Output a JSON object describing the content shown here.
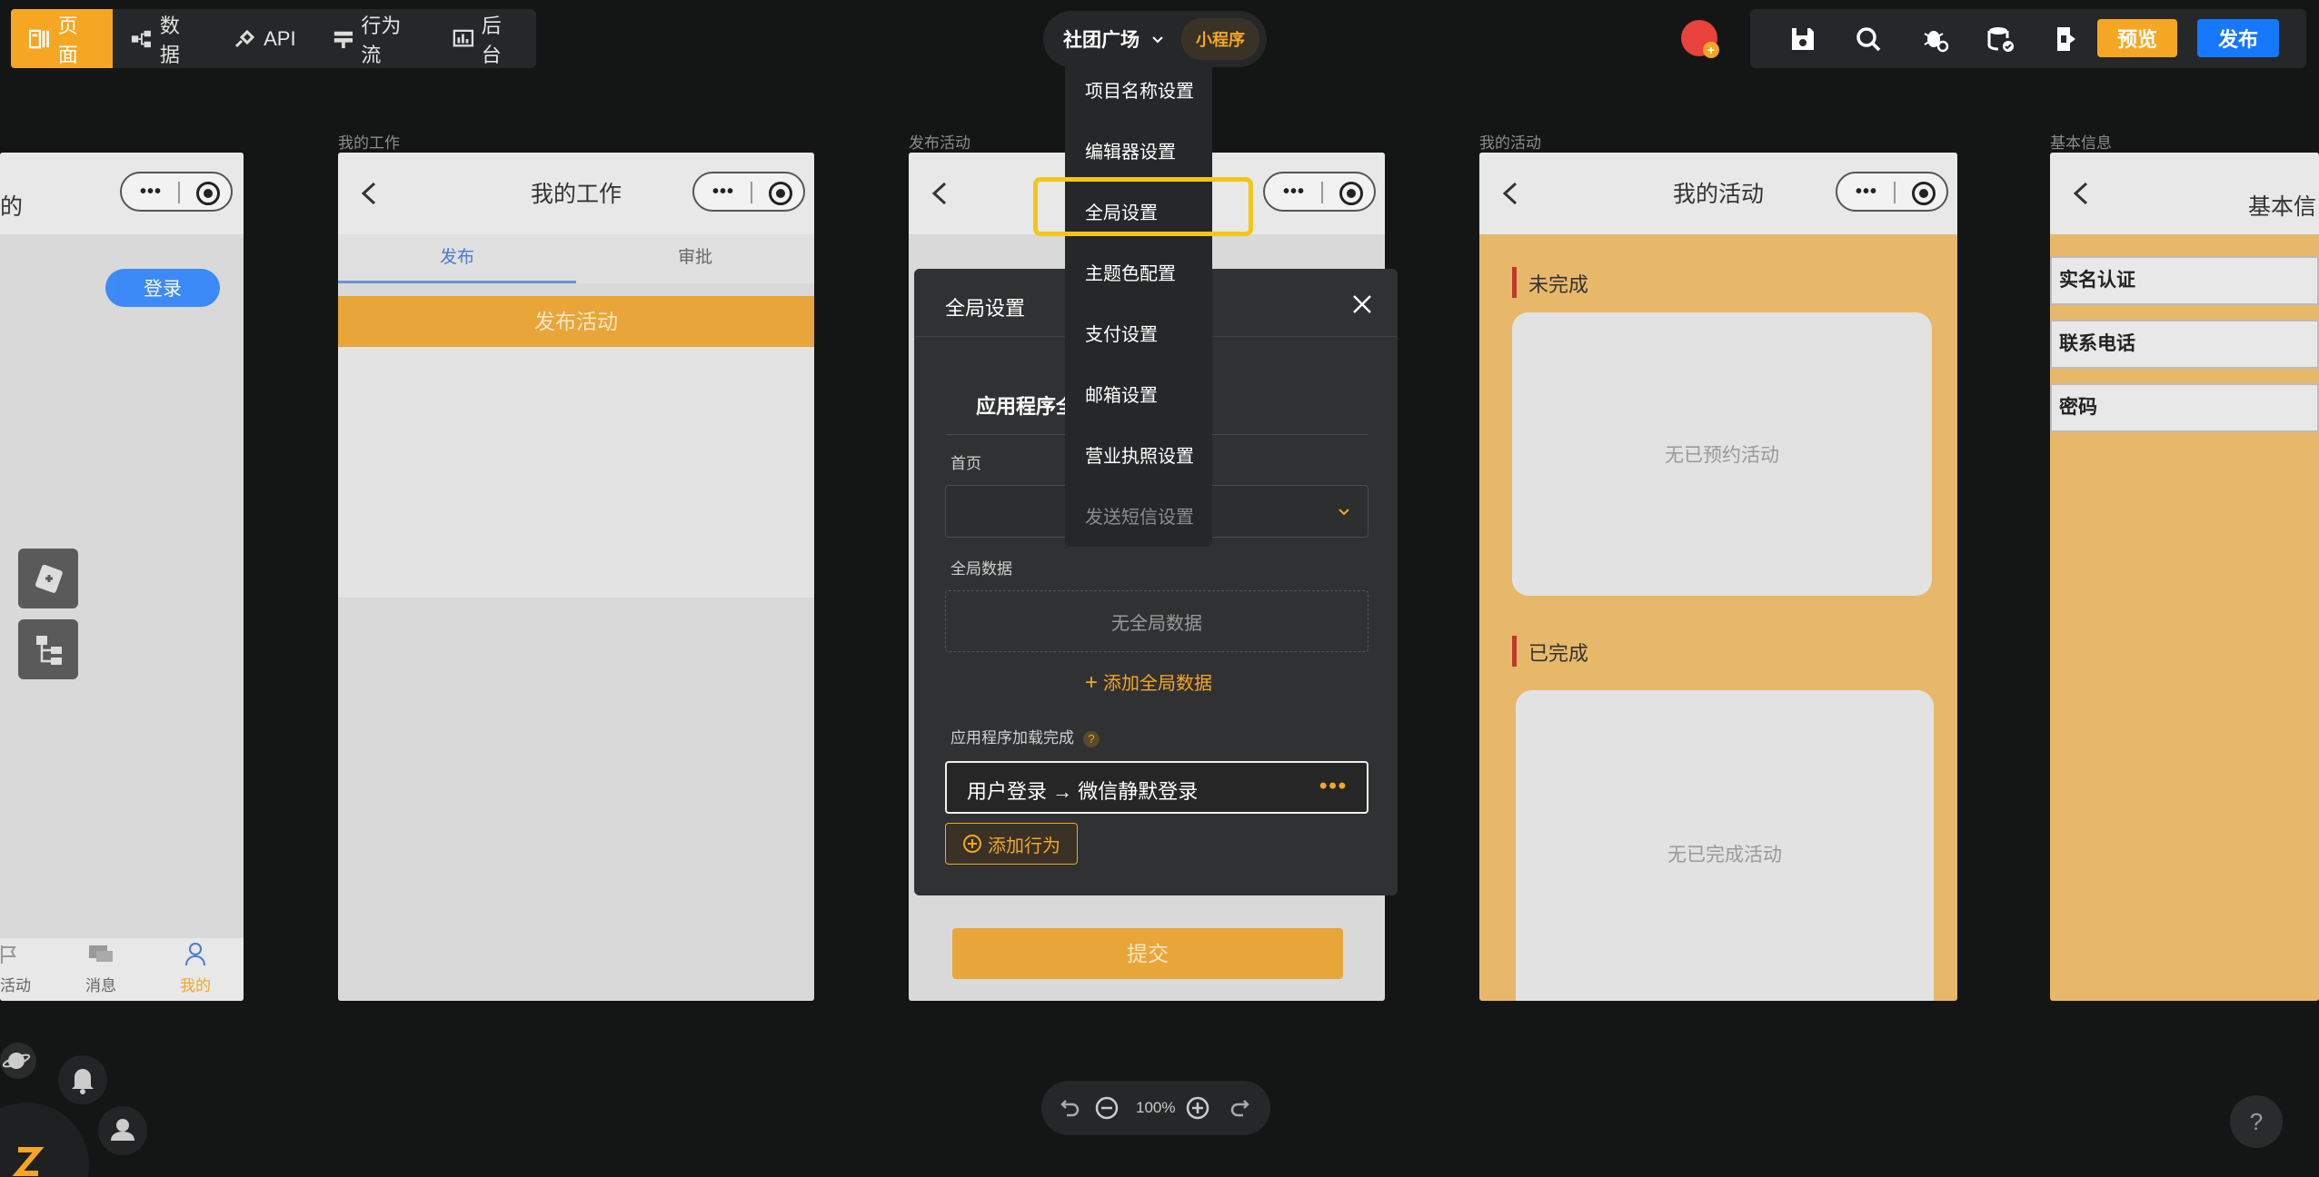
{
  "topnav": {
    "items": [
      {
        "label": "页面",
        "icon": "page-icon"
      },
      {
        "label": "数据",
        "icon": "data-icon"
      },
      {
        "label": "API",
        "icon": "api-icon"
      },
      {
        "label": "行为流",
        "icon": "workflow-icon"
      },
      {
        "label": "后台",
        "icon": "dashboard-icon"
      }
    ]
  },
  "project": {
    "name": "社团广场",
    "type": "小程序"
  },
  "toolbar": {
    "preview": "预览",
    "publish": "发布"
  },
  "frames": {
    "mine": {
      "title": "的",
      "login": "登录",
      "tabs": [
        "活动",
        "消息",
        "我的"
      ]
    },
    "my_work": {
      "label": "我的工作",
      "title": "我的工作",
      "tabs": [
        "发布",
        "审批"
      ],
      "button": "发布活动"
    },
    "publish": {
      "label": "发布活动",
      "submit": "提交"
    },
    "my_activity": {
      "label": "我的活动",
      "title": "我的活动",
      "section1": "未完成",
      "empty1": "无已预约活动",
      "section2": "已完成",
      "empty2": "无已完成活动"
    },
    "basic": {
      "label": "基本信息",
      "title": "基本信",
      "fields": [
        "实名认证",
        "联系电话",
        "密码"
      ]
    }
  },
  "menu": {
    "items": [
      "项目名称设置",
      "编辑器设置",
      "全局设置",
      "主题色配置",
      "支付设置",
      "邮箱设置",
      "营业执照设置",
      "发送短信设置"
    ]
  },
  "modal": {
    "title": "全局设置",
    "section": "应用程序全",
    "homepage_label": "首页",
    "global_data_label": "全局数据",
    "global_data_empty": "无全局数据",
    "add_global_data": "添加全局数据",
    "on_load_label": "应用程序加载完成",
    "on_load_action": "用户登录 → 微信静默登录",
    "add_behavior": "添加行为"
  },
  "zoom": {
    "level": "100%"
  },
  "help": "?",
  "colors": {
    "accent": "#f5a623",
    "primary": "#1677ff",
    "highlight": "#f5c518"
  }
}
